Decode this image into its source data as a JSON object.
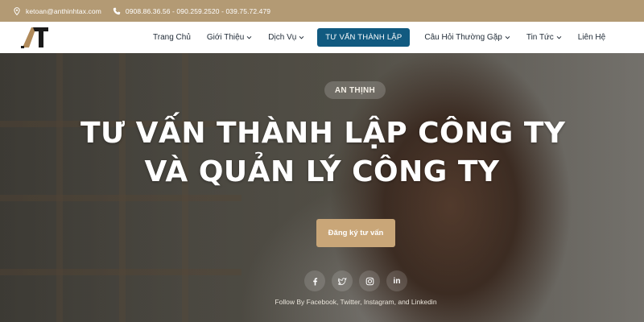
{
  "topbar": {
    "email": "ketoan@anthinhtax.com",
    "phones": "0908.86.36.56 - 090.259.2520 - 039.75.72.479"
  },
  "nav": {
    "items": [
      {
        "label": "Trang Chủ",
        "dropdown": false,
        "active": false
      },
      {
        "label": "Giới Thiệu",
        "dropdown": true,
        "active": false
      },
      {
        "label": "Dịch Vụ",
        "dropdown": true,
        "active": false
      },
      {
        "label": "TƯ VẤN THÀNH LẬP",
        "dropdown": false,
        "active": true
      },
      {
        "label": "Câu Hỏi Thường Gặp",
        "dropdown": true,
        "active": false
      },
      {
        "label": "Tin Tức",
        "dropdown": true,
        "active": false
      },
      {
        "label": "Liên Hệ",
        "dropdown": false,
        "active": false
      }
    ]
  },
  "hero": {
    "badge": "AN THỊNH",
    "title_line1": "TƯ VẤN THÀNH LẬP CÔNG TY",
    "title_line2": "VÀ QUẢN LÝ CÔNG TY",
    "cta_label": "Đăng ký tư vấn",
    "socials": [
      {
        "icon": "facebook-icon"
      },
      {
        "icon": "twitter-icon"
      },
      {
        "icon": "instagram-icon"
      },
      {
        "icon": "linkedin-icon",
        "text": "in"
      }
    ],
    "follow_text": "Follow By Facebook, Twitter, Instagram, and Linkedin"
  },
  "colors": {
    "topbar_bg": "#b39a74",
    "nav_active_bg": "#115a80",
    "cta_bg": "#c9a678"
  }
}
